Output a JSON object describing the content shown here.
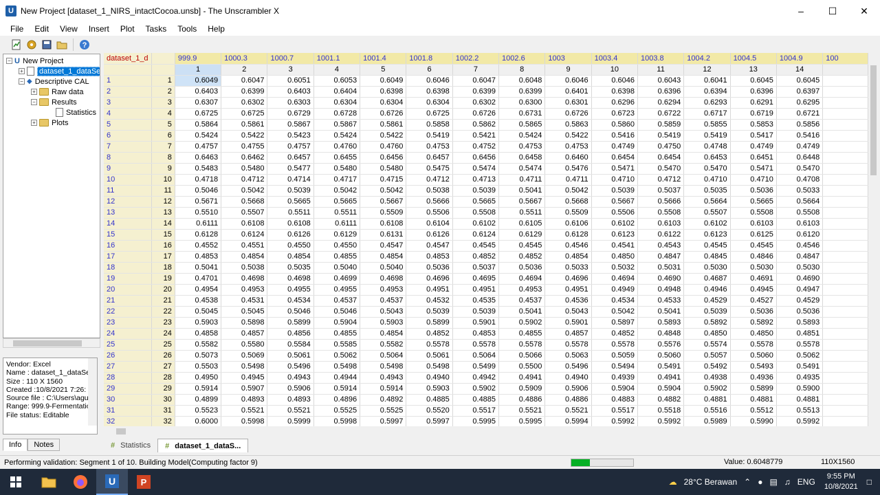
{
  "window": {
    "title": "New Project [dataset_1_NIRS_intactCocoa.unsb] - The Unscrambler X"
  },
  "menu": [
    "File",
    "Edit",
    "View",
    "Insert",
    "Plot",
    "Tasks",
    "Tools",
    "Help"
  ],
  "tree": {
    "root": "New Project",
    "dataset": "dataset_1_dataSe",
    "analysis": "Descriptive CAL",
    "raw": "Raw data",
    "results": "Results",
    "statistics": "Statistics",
    "plots": "Plots"
  },
  "info": {
    "lines": [
      "Vendor: Excel",
      "Name : dataset_1_dataSe",
      "Size : 110 X 1560",
      "Created :10/8/2021 7:26:",
      "Source file : C:\\Users\\agu",
      "Range: 999.9-Fermentatio",
      "File status: Editable"
    ],
    "tabs": [
      "Info",
      "Notes"
    ]
  },
  "grid": {
    "corner": "dataset_1_d",
    "var_names": [
      "999.9",
      "1000.3",
      "1000.7",
      "1001.1",
      "1001.4",
      "1001.8",
      "1002.2",
      "1002.6",
      "1003",
      "1003.4",
      "1003.8",
      "1004.2",
      "1004.5",
      "1004.9",
      "100"
    ],
    "col_nums": [
      "1",
      "2",
      "3",
      "4",
      "5",
      "6",
      "7",
      "8",
      "9",
      "10",
      "11",
      "12",
      "13",
      "14",
      ""
    ],
    "rows": [
      [
        "0.6049",
        "0.6047",
        "0.6051",
        "0.6053",
        "0.6049",
        "0.6046",
        "0.6047",
        "0.6048",
        "0.6046",
        "0.6046",
        "0.6043",
        "0.6041",
        "0.6045",
        "0.6045"
      ],
      [
        "0.6403",
        "0.6399",
        "0.6403",
        "0.6404",
        "0.6398",
        "0.6398",
        "0.6399",
        "0.6399",
        "0.6401",
        "0.6398",
        "0.6396",
        "0.6394",
        "0.6396",
        "0.6397"
      ],
      [
        "0.6307",
        "0.6302",
        "0.6303",
        "0.6304",
        "0.6304",
        "0.6304",
        "0.6302",
        "0.6300",
        "0.6301",
        "0.6296",
        "0.6294",
        "0.6293",
        "0.6291",
        "0.6295"
      ],
      [
        "0.6725",
        "0.6725",
        "0.6729",
        "0.6728",
        "0.6726",
        "0.6725",
        "0.6726",
        "0.6731",
        "0.6726",
        "0.6723",
        "0.6722",
        "0.6717",
        "0.6719",
        "0.6721"
      ],
      [
        "0.5864",
        "0.5861",
        "0.5867",
        "0.5867",
        "0.5861",
        "0.5858",
        "0.5862",
        "0.5865",
        "0.5863",
        "0.5860",
        "0.5859",
        "0.5855",
        "0.5853",
        "0.5856"
      ],
      [
        "0.5424",
        "0.5422",
        "0.5423",
        "0.5424",
        "0.5422",
        "0.5419",
        "0.5421",
        "0.5424",
        "0.5422",
        "0.5416",
        "0.5419",
        "0.5419",
        "0.5417",
        "0.5416"
      ],
      [
        "0.4757",
        "0.4755",
        "0.4757",
        "0.4760",
        "0.4760",
        "0.4753",
        "0.4752",
        "0.4753",
        "0.4753",
        "0.4749",
        "0.4750",
        "0.4748",
        "0.4749",
        "0.4749"
      ],
      [
        "0.6463",
        "0.6462",
        "0.6457",
        "0.6455",
        "0.6456",
        "0.6457",
        "0.6456",
        "0.6458",
        "0.6460",
        "0.6454",
        "0.6454",
        "0.6453",
        "0.6451",
        "0.6448"
      ],
      [
        "0.5483",
        "0.5480",
        "0.5477",
        "0.5480",
        "0.5480",
        "0.5475",
        "0.5474",
        "0.5474",
        "0.5476",
        "0.5471",
        "0.5470",
        "0.5470",
        "0.5471",
        "0.5470"
      ],
      [
        "0.4718",
        "0.4712",
        "0.4714",
        "0.4717",
        "0.4715",
        "0.4712",
        "0.4713",
        "0.4711",
        "0.4711",
        "0.4710",
        "0.4712",
        "0.4710",
        "0.4710",
        "0.4708"
      ],
      [
        "0.5046",
        "0.5042",
        "0.5039",
        "0.5042",
        "0.5042",
        "0.5038",
        "0.5039",
        "0.5041",
        "0.5042",
        "0.5039",
        "0.5037",
        "0.5035",
        "0.5036",
        "0.5033"
      ],
      [
        "0.5671",
        "0.5668",
        "0.5665",
        "0.5665",
        "0.5667",
        "0.5666",
        "0.5665",
        "0.5667",
        "0.5668",
        "0.5667",
        "0.5666",
        "0.5664",
        "0.5665",
        "0.5664"
      ],
      [
        "0.5510",
        "0.5507",
        "0.5511",
        "0.5511",
        "0.5509",
        "0.5506",
        "0.5508",
        "0.5511",
        "0.5509",
        "0.5506",
        "0.5508",
        "0.5507",
        "0.5508",
        "0.5508"
      ],
      [
        "0.6111",
        "0.6108",
        "0.6108",
        "0.6111",
        "0.6108",
        "0.6104",
        "0.6102",
        "0.6105",
        "0.6106",
        "0.6102",
        "0.6103",
        "0.6102",
        "0.6103",
        "0.6103"
      ],
      [
        "0.6128",
        "0.6124",
        "0.6126",
        "0.6129",
        "0.6131",
        "0.6126",
        "0.6124",
        "0.6129",
        "0.6128",
        "0.6123",
        "0.6122",
        "0.6123",
        "0.6125",
        "0.6120"
      ],
      [
        "0.4552",
        "0.4551",
        "0.4550",
        "0.4550",
        "0.4547",
        "0.4547",
        "0.4545",
        "0.4545",
        "0.4546",
        "0.4541",
        "0.4543",
        "0.4545",
        "0.4545",
        "0.4546"
      ],
      [
        "0.4853",
        "0.4854",
        "0.4854",
        "0.4855",
        "0.4854",
        "0.4853",
        "0.4852",
        "0.4852",
        "0.4854",
        "0.4850",
        "0.4847",
        "0.4845",
        "0.4846",
        "0.4847"
      ],
      [
        "0.5041",
        "0.5038",
        "0.5035",
        "0.5040",
        "0.5040",
        "0.5036",
        "0.5037",
        "0.5036",
        "0.5033",
        "0.5032",
        "0.5031",
        "0.5030",
        "0.5030",
        "0.5030"
      ],
      [
        "0.4701",
        "0.4698",
        "0.4698",
        "0.4699",
        "0.4698",
        "0.4696",
        "0.4695",
        "0.4694",
        "0.4696",
        "0.4694",
        "0.4690",
        "0.4687",
        "0.4691",
        "0.4690"
      ],
      [
        "0.4954",
        "0.4953",
        "0.4955",
        "0.4955",
        "0.4953",
        "0.4951",
        "0.4951",
        "0.4953",
        "0.4951",
        "0.4949",
        "0.4948",
        "0.4946",
        "0.4945",
        "0.4947"
      ],
      [
        "0.4538",
        "0.4531",
        "0.4534",
        "0.4537",
        "0.4537",
        "0.4532",
        "0.4535",
        "0.4537",
        "0.4536",
        "0.4534",
        "0.4533",
        "0.4529",
        "0.4527",
        "0.4529"
      ],
      [
        "0.5045",
        "0.5045",
        "0.5046",
        "0.5046",
        "0.5043",
        "0.5039",
        "0.5039",
        "0.5041",
        "0.5043",
        "0.5042",
        "0.5041",
        "0.5039",
        "0.5036",
        "0.5036"
      ],
      [
        "0.5903",
        "0.5898",
        "0.5899",
        "0.5904",
        "0.5903",
        "0.5899",
        "0.5901",
        "0.5902",
        "0.5901",
        "0.5897",
        "0.5893",
        "0.5892",
        "0.5892",
        "0.5893"
      ],
      [
        "0.4858",
        "0.4857",
        "0.4856",
        "0.4855",
        "0.4854",
        "0.4852",
        "0.4853",
        "0.4855",
        "0.4857",
        "0.4852",
        "0.4848",
        "0.4850",
        "0.4850",
        "0.4851"
      ],
      [
        "0.5582",
        "0.5580",
        "0.5584",
        "0.5585",
        "0.5582",
        "0.5578",
        "0.5578",
        "0.5578",
        "0.5578",
        "0.5578",
        "0.5576",
        "0.5574",
        "0.5578",
        "0.5578"
      ],
      [
        "0.5073",
        "0.5069",
        "0.5061",
        "0.5062",
        "0.5064",
        "0.5061",
        "0.5064",
        "0.5066",
        "0.5063",
        "0.5059",
        "0.5060",
        "0.5057",
        "0.5060",
        "0.5062"
      ],
      [
        "0.5503",
        "0.5498",
        "0.5496",
        "0.5498",
        "0.5498",
        "0.5498",
        "0.5499",
        "0.5500",
        "0.5496",
        "0.5494",
        "0.5491",
        "0.5492",
        "0.5493",
        "0.5491"
      ],
      [
        "0.4950",
        "0.4945",
        "0.4943",
        "0.4944",
        "0.4943",
        "0.4940",
        "0.4942",
        "0.4941",
        "0.4940",
        "0.4939",
        "0.4941",
        "0.4938",
        "0.4936",
        "0.4935"
      ],
      [
        "0.5914",
        "0.5907",
        "0.5906",
        "0.5914",
        "0.5914",
        "0.5903",
        "0.5902",
        "0.5909",
        "0.5906",
        "0.5904",
        "0.5904",
        "0.5902",
        "0.5899",
        "0.5900"
      ],
      [
        "0.4899",
        "0.4893",
        "0.4893",
        "0.4896",
        "0.4892",
        "0.4885",
        "0.4885",
        "0.4886",
        "0.4886",
        "0.4883",
        "0.4882",
        "0.4881",
        "0.4881",
        "0.4881"
      ],
      [
        "0.5523",
        "0.5521",
        "0.5521",
        "0.5525",
        "0.5525",
        "0.5520",
        "0.5517",
        "0.5521",
        "0.5521",
        "0.5517",
        "0.5518",
        "0.5516",
        "0.5512",
        "0.5513"
      ],
      [
        "0.6000",
        "0.5998",
        "0.5999",
        "0.5998",
        "0.5997",
        "0.5997",
        "0.5995",
        "0.5995",
        "0.5994",
        "0.5992",
        "0.5992",
        "0.5989",
        "0.5990",
        "0.5992"
      ]
    ]
  },
  "doc_tabs": [
    "Statistics",
    "dataset_1_dataS..."
  ],
  "status": {
    "message": "Performing validation: Segment 1 of 10. Building Model(Computing factor 9)",
    "progress": 0.3,
    "value": "Value: 0.6048779",
    "size": "110X1560"
  },
  "taskbar": {
    "weather": "28°C  Berawan",
    "lang": "ENG",
    "time": "9:55 PM",
    "date": "10/8/2021"
  }
}
